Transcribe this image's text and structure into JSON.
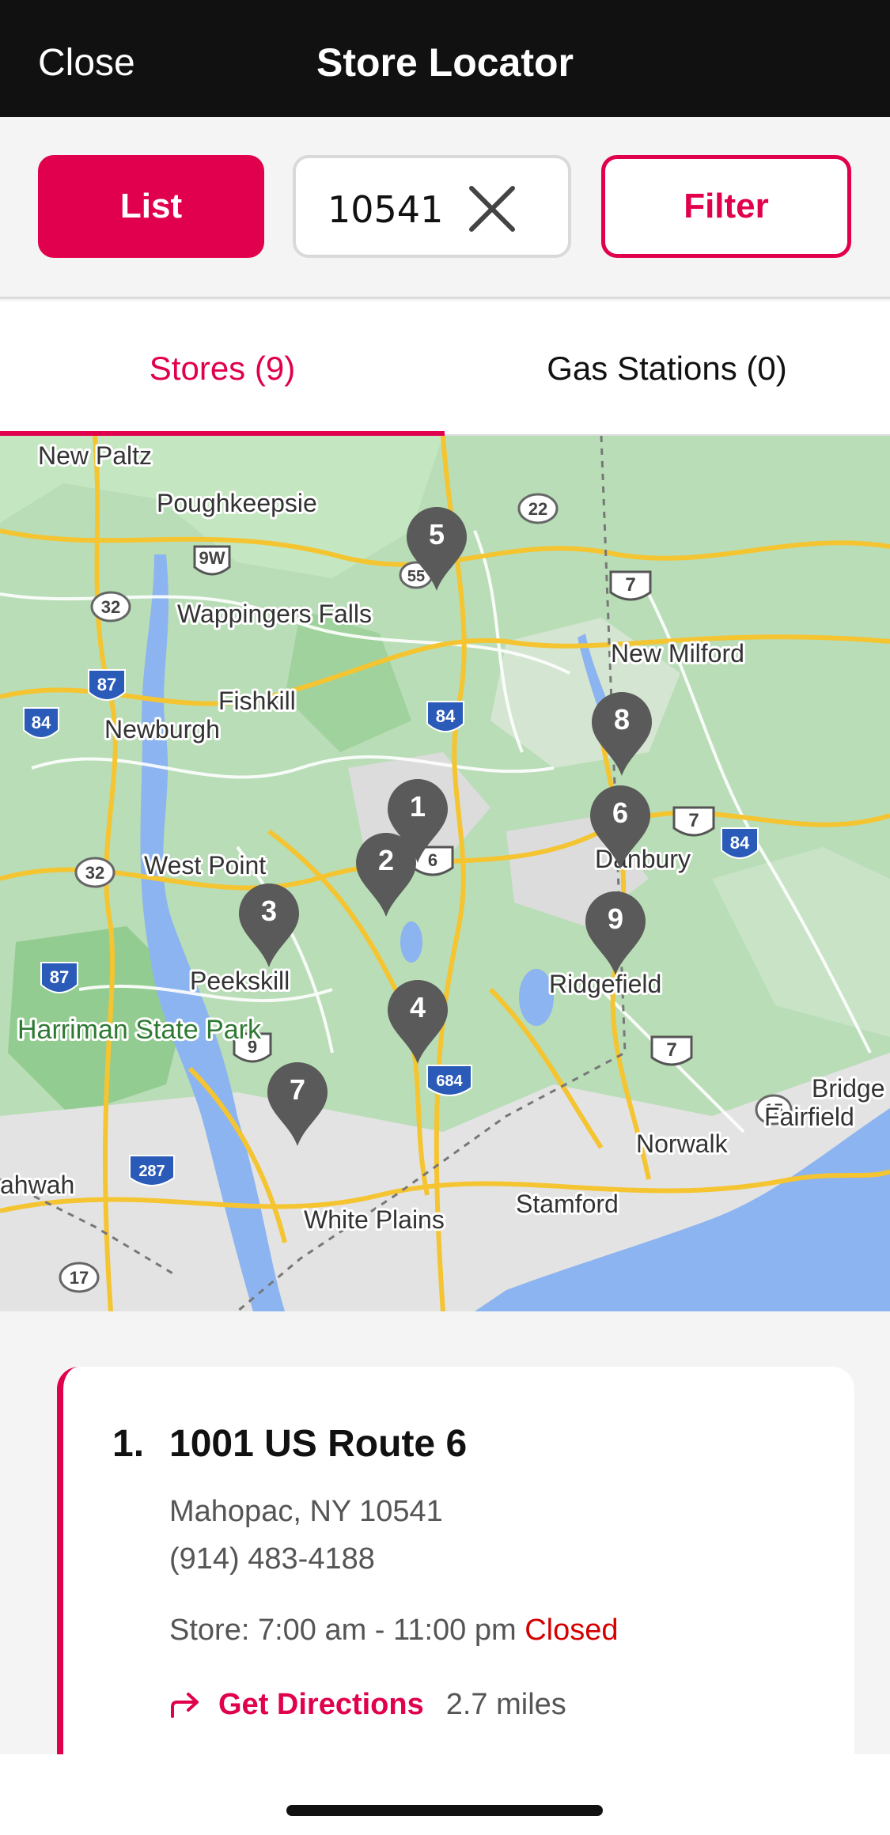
{
  "header": {
    "close_label": "Close",
    "title": "Store Locator"
  },
  "controls": {
    "list_label": "List",
    "zip_value": "10541",
    "filter_label": "Filter"
  },
  "tabs": [
    {
      "label": "Stores (9)",
      "active": true
    },
    {
      "label": "Gas Stations (0)",
      "active": false
    }
  ],
  "map": {
    "places": [
      "New Paltz",
      "Poughkeepsie",
      "Wappingers Falls",
      "Fishkill",
      "Newburgh",
      "West Point",
      "Peekskill",
      "Harriman State Park",
      "New Milford",
      "Danbury",
      "Ridgefield",
      "Norwalk",
      "Fairfield",
      "Stamford",
      "White Plains",
      "ahwah",
      "Bridge"
    ],
    "shields": [
      "22",
      "9W",
      "32",
      "55",
      "7",
      "87",
      "84",
      "84",
      "7",
      "84",
      "6",
      "32",
      "87",
      "9",
      "684",
      "7",
      "15",
      "287",
      "17"
    ],
    "pins": [
      "1",
      "2",
      "3",
      "4",
      "5",
      "6",
      "7",
      "8",
      "9"
    ]
  },
  "store": {
    "number": "1.",
    "address": "1001 US Route 6",
    "city": "Mahopac, NY 10541",
    "phone": "(914) 483-4188",
    "hours_label": "Store: 7:00 am - 11:00 pm",
    "status": "Closed",
    "directions_label": "Get Directions",
    "distance": "2.7 miles"
  },
  "colors": {
    "accent": "#e0004d",
    "status_closed": "#d40000",
    "header_bg": "#111111"
  }
}
